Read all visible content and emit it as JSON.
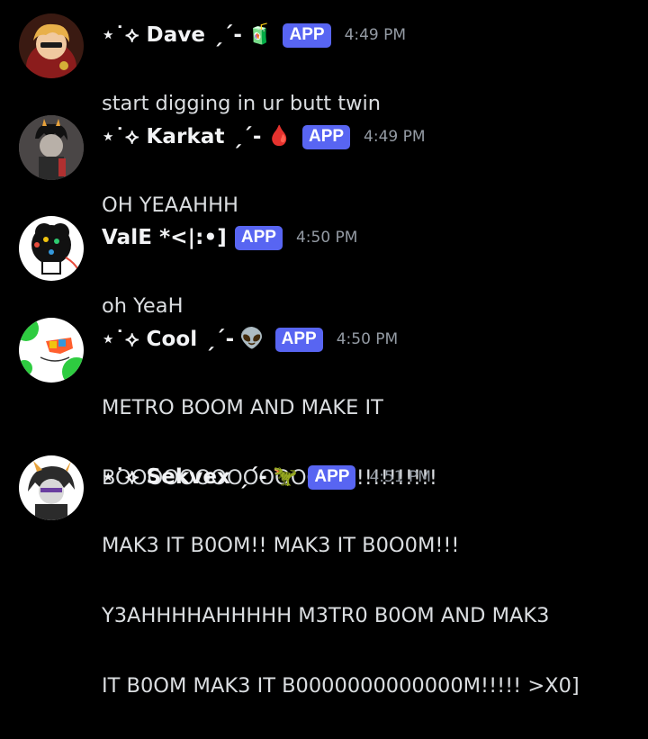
{
  "messages": [
    {
      "username": "⋆˙⟡ Dave ˏˋ°•*⁀➷",
      "display_name": "⋆˙⟡ Dave ˏ´-",
      "emoji": "🧃",
      "badge": "APP",
      "timestamp": "4:49 PM",
      "lines": [
        "start digging in ur butt twin"
      ],
      "accent": "#c0392b"
    },
    {
      "display_name": "⋆˙⟡ Karkat ˏ´-",
      "emoji": "🩸",
      "badge": "APP",
      "timestamp": "4:49 PM",
      "lines": [
        "OH YEAAHHH"
      ],
      "accent": "#7a1f1f"
    },
    {
      "display_name": "ValE *<|:•]",
      "emoji": "",
      "badge": "APP",
      "timestamp": "4:50 PM",
      "lines": [
        "oh YeaH"
      ],
      "accent": "#e74c3c"
    },
    {
      "display_name": "⋆˙⟡ Cool ˏ´-",
      "emoji": "👽",
      "badge": "APP",
      "timestamp": "4:50 PM",
      "lines": [
        "METRO BOOM AND MAKE IT",
        "BOOOOOOOOOOOOOM!!!!!!!!!!!!"
      ],
      "accent": "#2ecc40"
    },
    {
      "display_name": "⋆˙⟡ Sekvex ˏ´-",
      "emoji": "🦖",
      "badge": "APP",
      "timestamp": "4:51 PM",
      "lines": [
        "MAK3 IT B0OM!! MAK3 IT B0O0M!!!",
        "Y3AHHHHAHHHHH M3TR0 B0OM AND MAK3",
        "IT B0OM MAK3 IT B0000000000000M!!!!! >X0]"
      ],
      "accent": "#6a3fa0"
    }
  ]
}
